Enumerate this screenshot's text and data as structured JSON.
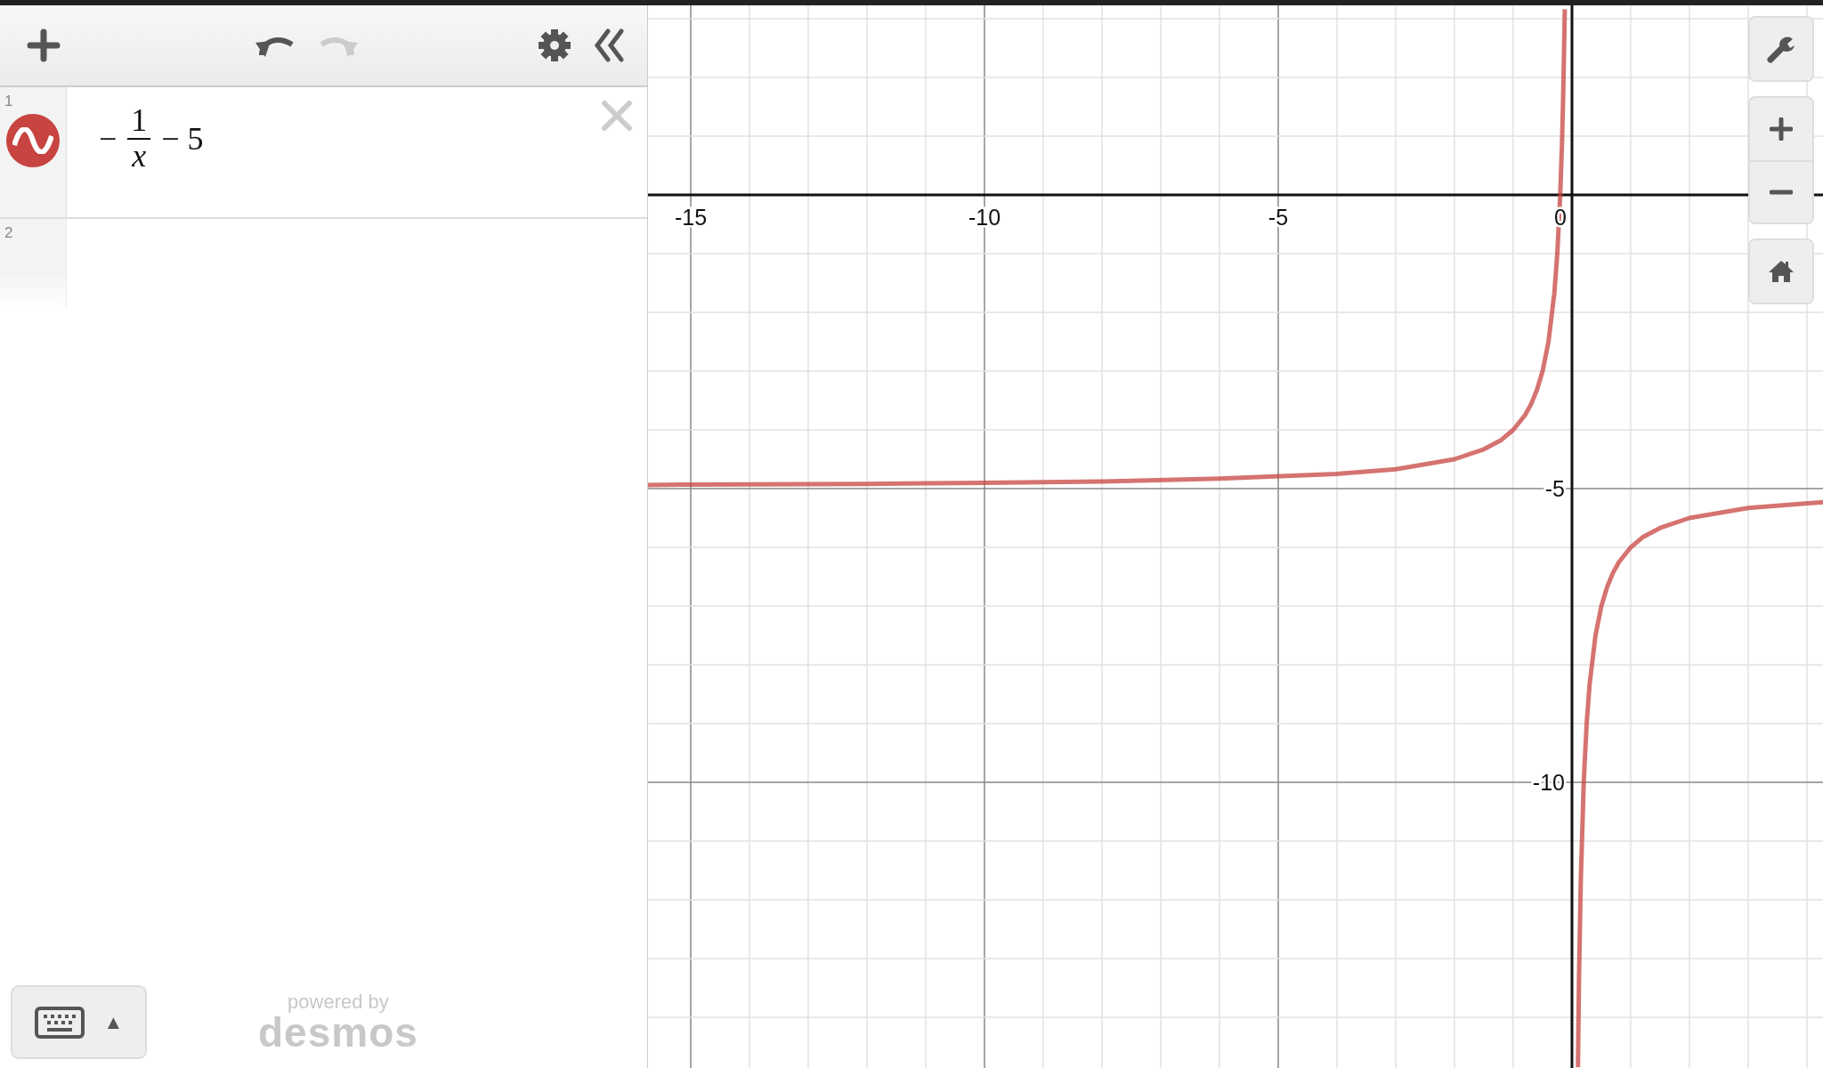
{
  "toolbar": {
    "buttons": [
      {
        "kind": "add",
        "disabled": false
      },
      {
        "kind": "undo",
        "disabled": false
      },
      {
        "kind": "redo",
        "disabled": true
      },
      {
        "kind": "settings",
        "disabled": false
      },
      {
        "kind": "collapse",
        "disabled": false
      }
    ]
  },
  "expressions": [
    {
      "number": "1",
      "color": "#c74440",
      "sign": "−",
      "numerator": "1",
      "denominator": "x",
      "rest": "− 5"
    },
    {
      "number": "2"
    }
  ],
  "keyboard_button": {
    "caret": "▲"
  },
  "branding": {
    "line1": "powered by",
    "line2": "desmos"
  },
  "graph_controls": [
    {
      "kind": "settings"
    },
    {
      "kind": "zoom-in"
    },
    {
      "kind": "zoom-out"
    },
    {
      "kind": "home"
    }
  ],
  "graph": {
    "chart_data": {
      "type": "line",
      "grid": true,
      "xlim": [
        -15.727,
        4.273
      ],
      "ylim": [
        -14.864,
        3.227
      ],
      "xticks": [
        -15,
        -10,
        -5,
        0
      ],
      "yticks": [
        -5,
        -10
      ],
      "x": [
        -15.727,
        -15,
        -12,
        -10,
        -8,
        -6,
        -4,
        -3,
        -2,
        -1.5,
        -1.2,
        -1,
        -0.8,
        -0.7,
        -0.6,
        -0.5,
        -0.4,
        -0.3,
        -0.25,
        -0.2,
        -0.17,
        -0.15,
        -0.13,
        -0.1225,
        0.1015,
        0.12,
        0.15,
        0.2,
        0.25,
        0.3,
        0.4,
        0.5,
        0.6,
        0.7,
        0.8,
        1,
        1.2,
        1.5,
        2,
        3,
        4.273
      ],
      "series": [
        {
          "color": "#c74440",
          "values": [
            -4.94,
            -4.93,
            -4.92,
            -4.9,
            -4.88,
            -4.83,
            -4.75,
            -4.67,
            -4.5,
            -4.33,
            -4.17,
            -4,
            -3.75,
            -3.57,
            -3.33,
            -3,
            -2.5,
            -1.67,
            -1,
            0,
            0.88,
            1.67,
            2.69,
            3.16,
            -14.85,
            -13.33,
            -11.67,
            -10,
            -9,
            -8.33,
            -7.5,
            -7,
            -6.67,
            -6.43,
            -6.25,
            -6,
            -5.83,
            -5.67,
            -5.5,
            -5.33,
            -5.23
          ]
        }
      ]
    }
  }
}
